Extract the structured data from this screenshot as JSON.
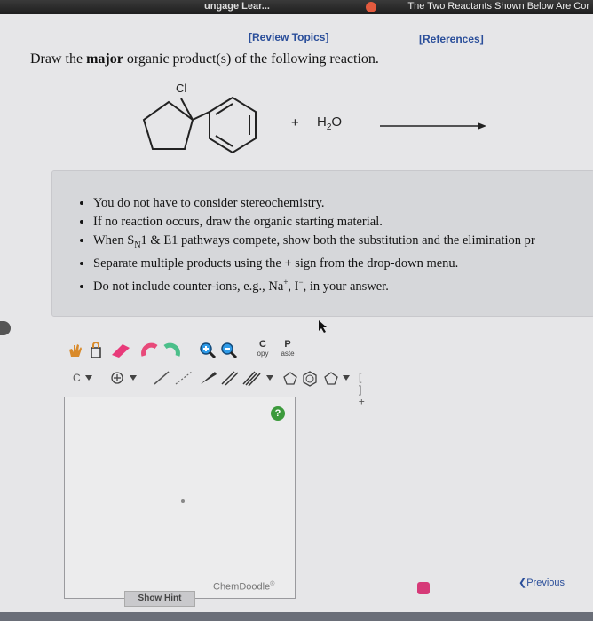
{
  "topbar": {
    "left_text": "ungage Lear...",
    "right_text": "The Two Reactants Shown Below Are Cor"
  },
  "links": {
    "review_topics": "[Review Topics]",
    "references": "[References]"
  },
  "question": {
    "prefix": "Draw the ",
    "bold": "major",
    "suffix": " organic product(s) of the following reaction."
  },
  "reaction": {
    "substituent": "Cl",
    "plus": "+",
    "reagent_main": "H",
    "reagent_sub": "2",
    "reagent_tail": "O"
  },
  "notes": [
    "You do not have to consider stereochemistry.",
    "If no reaction occurs, draw the organic starting material.",
    "When S_N1 & E1 pathways compete, show both the substitution and the elimination pr",
    "Separate multiple products using the + sign from the drop-down menu.",
    "Do not include counter-ions, e.g., Na⁺, I⁻, in your answer."
  ],
  "note3": {
    "a": "When S",
    "sub": "N",
    "b": "1 & E1 pathways compete, show both the substitution and the elimination pr"
  },
  "note5": {
    "a": "Do not include counter-ions, e.g., Na",
    "sup1": "+",
    "b": ", I",
    "sup2": "−",
    "c": ", in your answer."
  },
  "toolbar": {
    "copy_top": "C",
    "copy_bottom": "opy",
    "paste_top": "P",
    "paste_bottom": "aste",
    "c_label": "C",
    "bracket_label": "[ ]±"
  },
  "canvas": {
    "help": "?",
    "brand": "ChemDoodle",
    "brand_mark": "®"
  },
  "buttons": {
    "show_hint": "Show Hint",
    "previous": "Previous"
  },
  "colors": {
    "link": "#2a4e9a",
    "help_green": "#3c9a3c",
    "pink": "#d63a78"
  }
}
